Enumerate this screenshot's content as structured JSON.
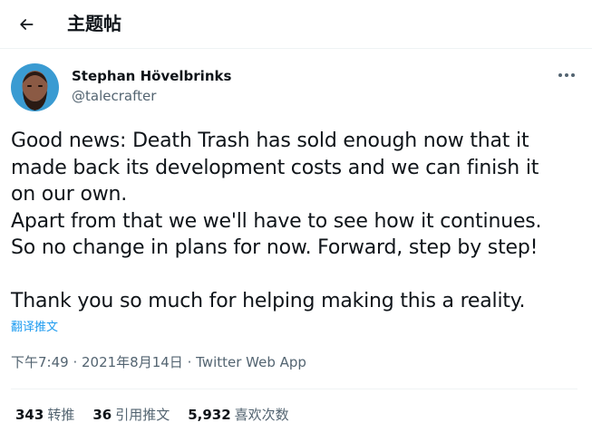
{
  "header": {
    "title": "主题帖"
  },
  "author": {
    "name": "Stephan Hövelbrinks",
    "handle": "@talecrafter"
  },
  "tweet": {
    "text": "Good news: Death Trash has sold enough now that it\nmade back its development costs and we can finish it\non our own.\nApart from that we we'll have to see how it continues.\nSo no change in plans for now. Forward, step by step!\n\nThank you so much for helping making this a reality.",
    "translate_label": "翻译推文"
  },
  "meta": {
    "time": "下午7:49",
    "separator": " · ",
    "date": "2021年8月14日",
    "source": "Twitter Web App"
  },
  "stats": [
    {
      "count": "343",
      "label": "转推"
    },
    {
      "count": "36",
      "label": "引用推文"
    },
    {
      "count": "5,932",
      "label": "喜欢次数"
    }
  ],
  "icons": {
    "back": "arrow-left-icon",
    "more": "more-horizontal-icon"
  },
  "colors": {
    "link": "#1d9bf0",
    "secondary_text": "#536471",
    "text": "#0f1419"
  }
}
